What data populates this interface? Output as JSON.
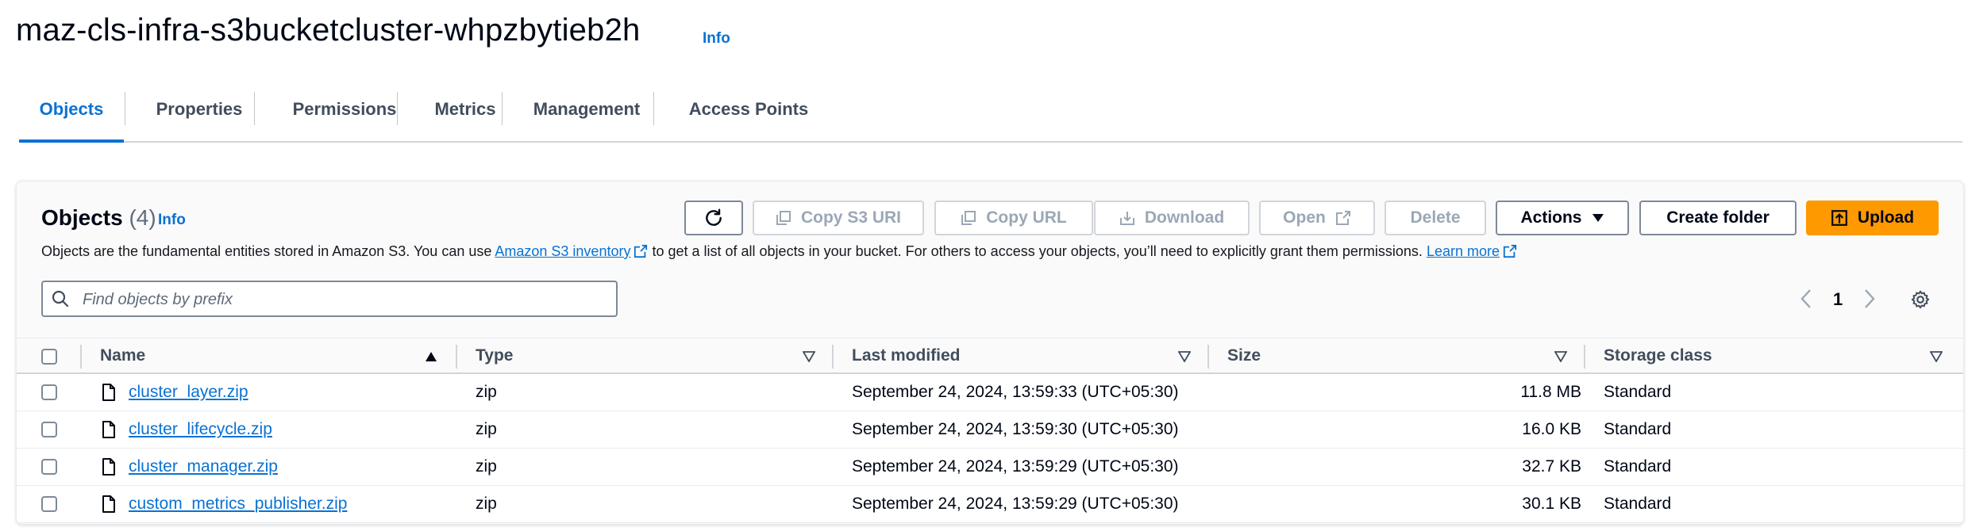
{
  "header": {
    "bucket_name": "maz-cls-infra-s3bucketcluster-whpzbytieb2h",
    "info_label": "Info"
  },
  "tabs": [
    {
      "label": "Objects",
      "active": true
    },
    {
      "label": "Properties",
      "active": false
    },
    {
      "label": "Permissions",
      "active": false
    },
    {
      "label": "Metrics",
      "active": false
    },
    {
      "label": "Management",
      "active": false
    },
    {
      "label": "Access Points",
      "active": false
    }
  ],
  "objects_panel": {
    "title": "Objects",
    "count": "(4)",
    "info_label": "Info",
    "description_prefix": "Objects are the fundamental entities stored in Amazon S3. You can use ",
    "inventory_link": "Amazon S3 inventory",
    "description_middle": " to get a list of all objects in your bucket. For others to access your objects, you’ll need to explicitly grant them permissions. ",
    "learn_more_link": "Learn more"
  },
  "toolbar": {
    "copy_s3_uri": "Copy S3 URI",
    "copy_url": "Copy URL",
    "download": "Download",
    "open": "Open",
    "delete": "Delete",
    "actions": "Actions",
    "create_folder": "Create folder",
    "upload": "Upload"
  },
  "search": {
    "placeholder": "Find objects by prefix",
    "value": ""
  },
  "pagination": {
    "current_page": "1"
  },
  "table": {
    "columns": [
      "Name",
      "Type",
      "Last modified",
      "Size",
      "Storage class"
    ],
    "rows": [
      {
        "name": "cluster_layer.zip",
        "type": "zip",
        "last_modified": "September 24, 2024, 13:59:33 (UTC+05:30)",
        "size": "11.8 MB",
        "storage_class": "Standard"
      },
      {
        "name": "cluster_lifecycle.zip",
        "type": "zip",
        "last_modified": "September 24, 2024, 13:59:30 (UTC+05:30)",
        "size": "16.0 KB",
        "storage_class": "Standard"
      },
      {
        "name": "cluster_manager.zip",
        "type": "zip",
        "last_modified": "September 24, 2024, 13:59:29 (UTC+05:30)",
        "size": "32.7 KB",
        "storage_class": "Standard"
      },
      {
        "name": "custom_metrics_publisher.zip",
        "type": "zip",
        "last_modified": "September 24, 2024, 13:59:29 (UTC+05:30)",
        "size": "30.1 KB",
        "storage_class": "Standard"
      }
    ]
  },
  "icons": {
    "refresh": "refresh-icon",
    "copy": "copy-icon",
    "download": "download-icon",
    "external": "external-link-icon",
    "caret": "caret-down-icon",
    "upload": "upload-icon",
    "search": "search-icon",
    "settings": "gear-icon",
    "file": "file-icon"
  },
  "colors": {
    "accent": "#0972d3",
    "primary_button": "#ff9900",
    "disabled_text": "#9ba7b6"
  }
}
